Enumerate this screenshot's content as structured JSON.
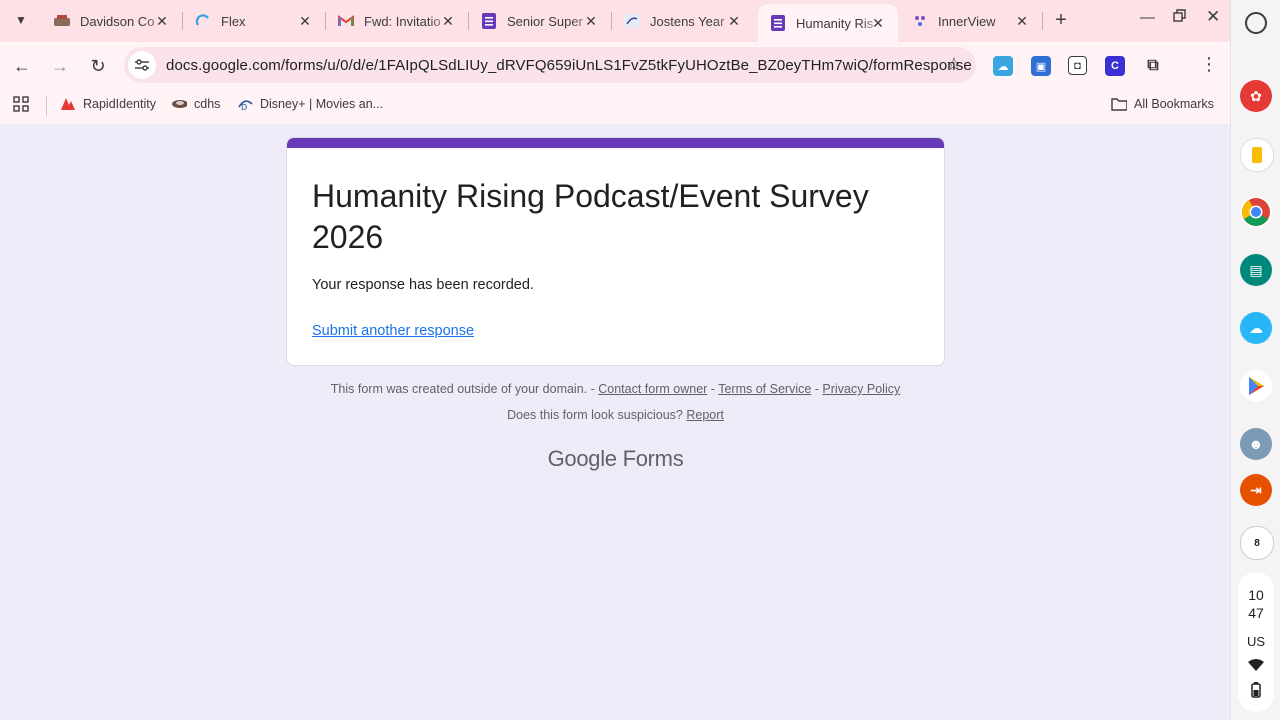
{
  "browser": {
    "tabs": [
      {
        "title": "Davidson Co",
        "favicon": "davidson-logo-icon",
        "active": false
      },
      {
        "title": "Flex",
        "favicon": "flex-icon",
        "active": false
      },
      {
        "title": "Fwd: Invitatio",
        "favicon": "gmail-icon",
        "active": false
      },
      {
        "title": "Senior Super",
        "favicon": "forms-icon",
        "active": false
      },
      {
        "title": "Jostens Year",
        "favicon": "jostens-icon",
        "active": false
      },
      {
        "title": "Humanity Ris",
        "favicon": "forms-icon",
        "active": true
      },
      {
        "title": "InnerView",
        "favicon": "innerview-icon",
        "active": false
      }
    ],
    "close_glyph": "✕",
    "url": "docs.google.com/forms/u/0/d/e/1FAIpQLSdLIUy_dRVFQ659iUnLS1FvZ5tkFyUHOztBe_BZ0eyTHm7wiQ/formResponse",
    "bookmarks": [
      {
        "label": "RapidIdentity",
        "icon": "rapididentity-icon"
      },
      {
        "label": "cdhs",
        "icon": "cdhs-icon"
      },
      {
        "label": "Disney+ | Movies an...",
        "icon": "disney-icon"
      }
    ],
    "all_bookmarks_label": "All Bookmarks"
  },
  "form": {
    "title": "Humanity Rising Podcast/Event Survey 2026",
    "confirmation": "Your response has been recorded.",
    "submit_another": "Submit another response",
    "accent_color": "#673ab7",
    "background_color": "#f0ebf8"
  },
  "footer": {
    "domain_notice": "This form was created outside of your domain.",
    "contact_owner": "Contact form owner",
    "terms": "Terms of Service",
    "privacy": "Privacy Policy",
    "sep": " - ",
    "suspicious": "Does this form look suspicious?",
    "report": "Report",
    "brand_google": "Google",
    "brand_forms": "Forms"
  },
  "system_tray": {
    "hour": "10",
    "minute": "47",
    "locale": "US"
  }
}
